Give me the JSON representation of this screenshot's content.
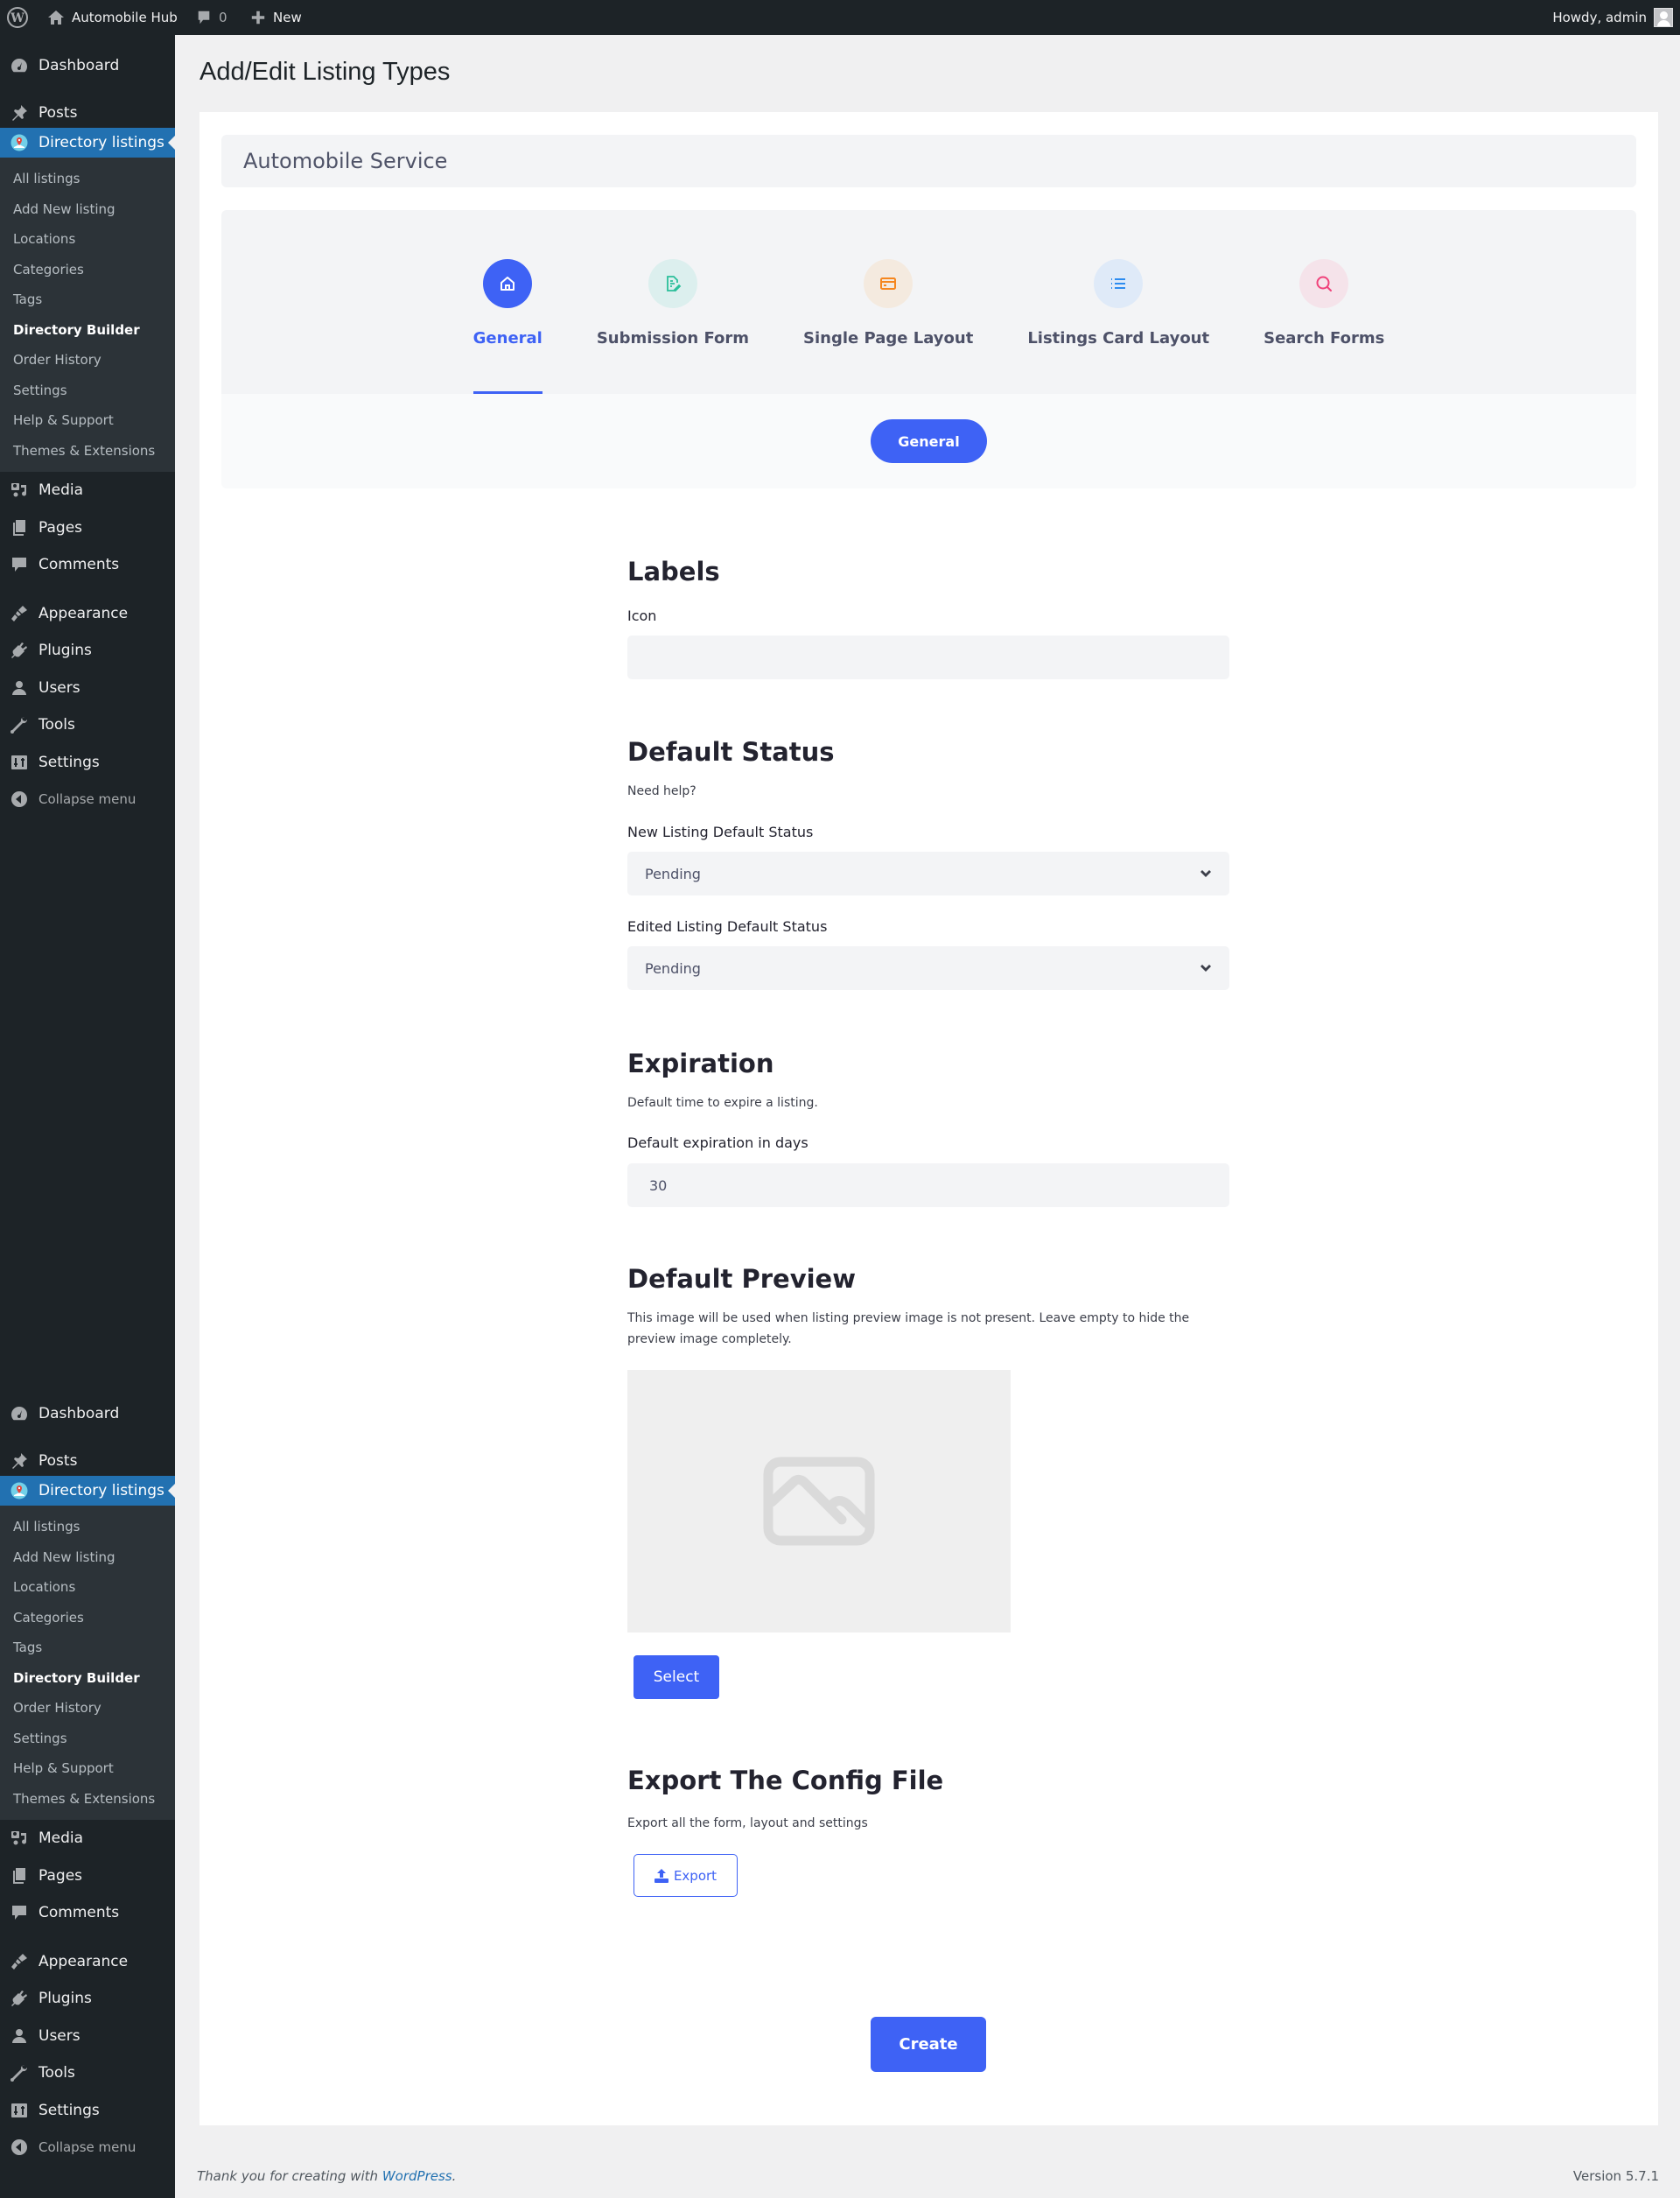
{
  "admin_bar": {
    "site_name": "Automobile Hub",
    "comments_count": "0",
    "new_label": "New",
    "howdy": "Howdy, admin"
  },
  "sidebar": {
    "top_items": [
      {
        "label": "Dashboard",
        "icon": "dashboard-icon"
      },
      {
        "label": "Posts",
        "icon": "pin-icon"
      },
      {
        "label": "Directory listings",
        "icon": "map-pin-icon",
        "current": true
      }
    ],
    "submenu": [
      {
        "label": "All listings"
      },
      {
        "label": "Add New listing"
      },
      {
        "label": "Locations"
      },
      {
        "label": "Categories"
      },
      {
        "label": "Tags"
      },
      {
        "label": "Directory Builder",
        "active": true
      },
      {
        "label": "Order History"
      },
      {
        "label": "Settings"
      },
      {
        "label": "Help & Support"
      },
      {
        "label": "Themes & Extensions"
      }
    ],
    "bottom_items": [
      {
        "label": "Media",
        "icon": "media-icon"
      },
      {
        "label": "Pages",
        "icon": "pages-icon"
      },
      {
        "label": "Comments",
        "icon": "comment-icon"
      },
      {
        "label": "Appearance",
        "icon": "brush-icon"
      },
      {
        "label": "Plugins",
        "icon": "plugin-icon"
      },
      {
        "label": "Users",
        "icon": "user-icon"
      },
      {
        "label": "Tools",
        "icon": "wrench-icon"
      },
      {
        "label": "Settings",
        "icon": "settings-icon"
      }
    ],
    "collapse_label": "Collapse menu"
  },
  "page": {
    "title": "Add/Edit Listing Types",
    "listing_type_name": "Automobile Service"
  },
  "tabs": [
    {
      "label": "General",
      "icon": "home-icon",
      "active": true,
      "color": "#3e62f5",
      "bg": "#3e62f5"
    },
    {
      "label": "Submission Form",
      "icon": "form-edit-icon",
      "color": "#2bbf9a",
      "bg": "#dcefee"
    },
    {
      "label": "Single Page Layout",
      "icon": "card-icon",
      "color": "#f5871f",
      "bg": "#f4eadf"
    },
    {
      "label": "Listings Card Layout",
      "icon": "list-icon",
      "color": "#2d8cf0",
      "bg": "#dfeaf8"
    },
    {
      "label": "Search Forms",
      "icon": "search-icon",
      "color": "#f0427a",
      "bg": "#f5e3ea"
    }
  ],
  "subtab": {
    "label": "General"
  },
  "form": {
    "labels": {
      "title": "Labels",
      "icon_label": "Icon",
      "icon_value": ""
    },
    "default_status": {
      "title": "Default Status",
      "help": "Need help?",
      "new_label": "New Listing Default Status",
      "new_value": "Pending",
      "edited_label": "Edited Listing Default Status",
      "edited_value": "Pending"
    },
    "expiration": {
      "title": "Expiration",
      "desc": "Default time to expire a listing.",
      "days_label": "Default expiration in days",
      "days_value": "30"
    },
    "default_preview": {
      "title": "Default Preview",
      "desc": "This image will be used when listing preview image is not present. Leave empty to hide the preview image completely.",
      "select_label": "Select"
    },
    "export": {
      "title": "Export The Config File",
      "desc": "Export all the form, layout and settings",
      "button_label": "Export"
    },
    "create_label": "Create"
  },
  "footer": {
    "thanks_prefix": "Thank you for creating with ",
    "thanks_link": "WordPress",
    "thanks_suffix": ".",
    "version": "Version 5.7.1"
  },
  "colors": {
    "accent": "#3e62f5",
    "wp_admin_dark": "#1d2327",
    "wp_admin_blue": "#2271b1"
  }
}
